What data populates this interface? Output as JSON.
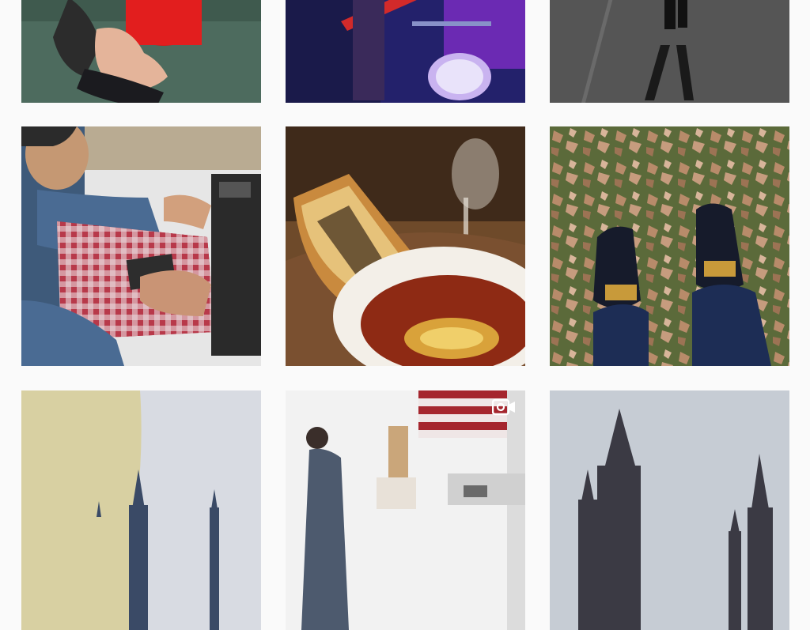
{
  "feed": {
    "posts": [
      {
        "id": "post-1",
        "subject": "hands-red-cup",
        "is_video": false
      },
      {
        "id": "post-2",
        "subject": "band-purple-stage",
        "is_video": false
      },
      {
        "id": "post-3",
        "subject": "pavement-shadow",
        "is_video": false
      },
      {
        "id": "post-4",
        "subject": "sewing-machine-man",
        "is_video": false
      },
      {
        "id": "post-5",
        "subject": "grilled-cheese-tomato-soup",
        "is_video": false
      },
      {
        "id": "post-6",
        "subject": "boots-autumn-leaves",
        "is_video": false
      },
      {
        "id": "post-7",
        "subject": "castle-torn-paper",
        "is_video": false
      },
      {
        "id": "post-8",
        "subject": "workshop-flag",
        "is_video": true
      },
      {
        "id": "post-9",
        "subject": "castle-towers-sky",
        "is_video": false
      }
    ]
  },
  "icons": {
    "video_badge": "video-camera-icon"
  },
  "colors": {
    "background": "#fafafa",
    "badge": "#ffffff"
  }
}
